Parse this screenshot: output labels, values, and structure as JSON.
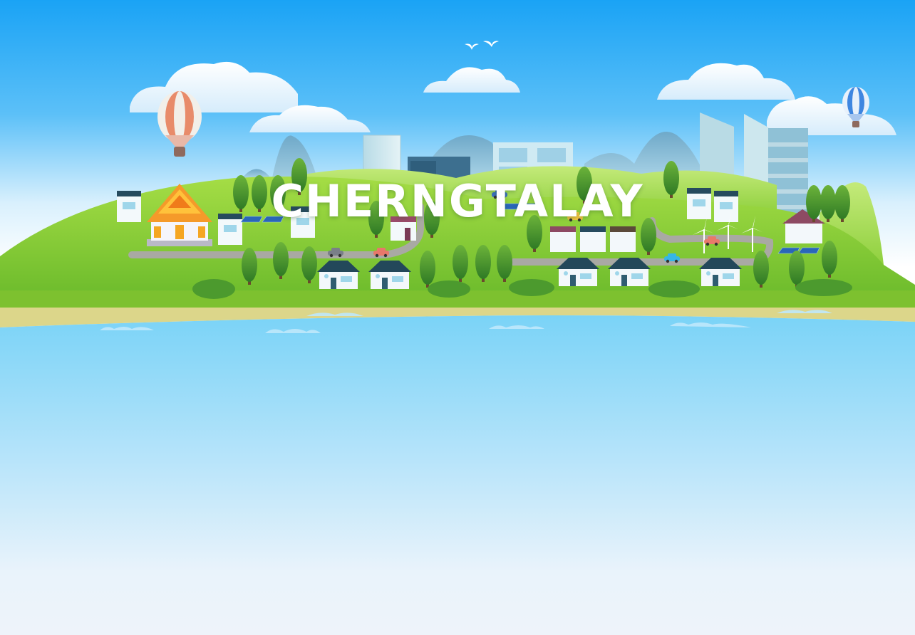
{
  "hero": {
    "title": "CHERNGTALAY"
  },
  "palette": {
    "sky_top": "#23a6f4",
    "sky_mid": "#9ad6fb",
    "hill_green": "#7cc534",
    "dark_green": "#3f8f2a",
    "sea": "#6fd0f6",
    "sand": "#dcd68a",
    "background_bottom": "#eef3fa",
    "balloon_left": "#e88b6a",
    "balloon_right": "#3f86e0"
  },
  "icons": [
    "temple-icon",
    "hot-air-balloon-icon",
    "wind-turbine-icon",
    "solar-panel-icon",
    "car-icon",
    "bird-icon",
    "tree-icon",
    "house-icon"
  ]
}
